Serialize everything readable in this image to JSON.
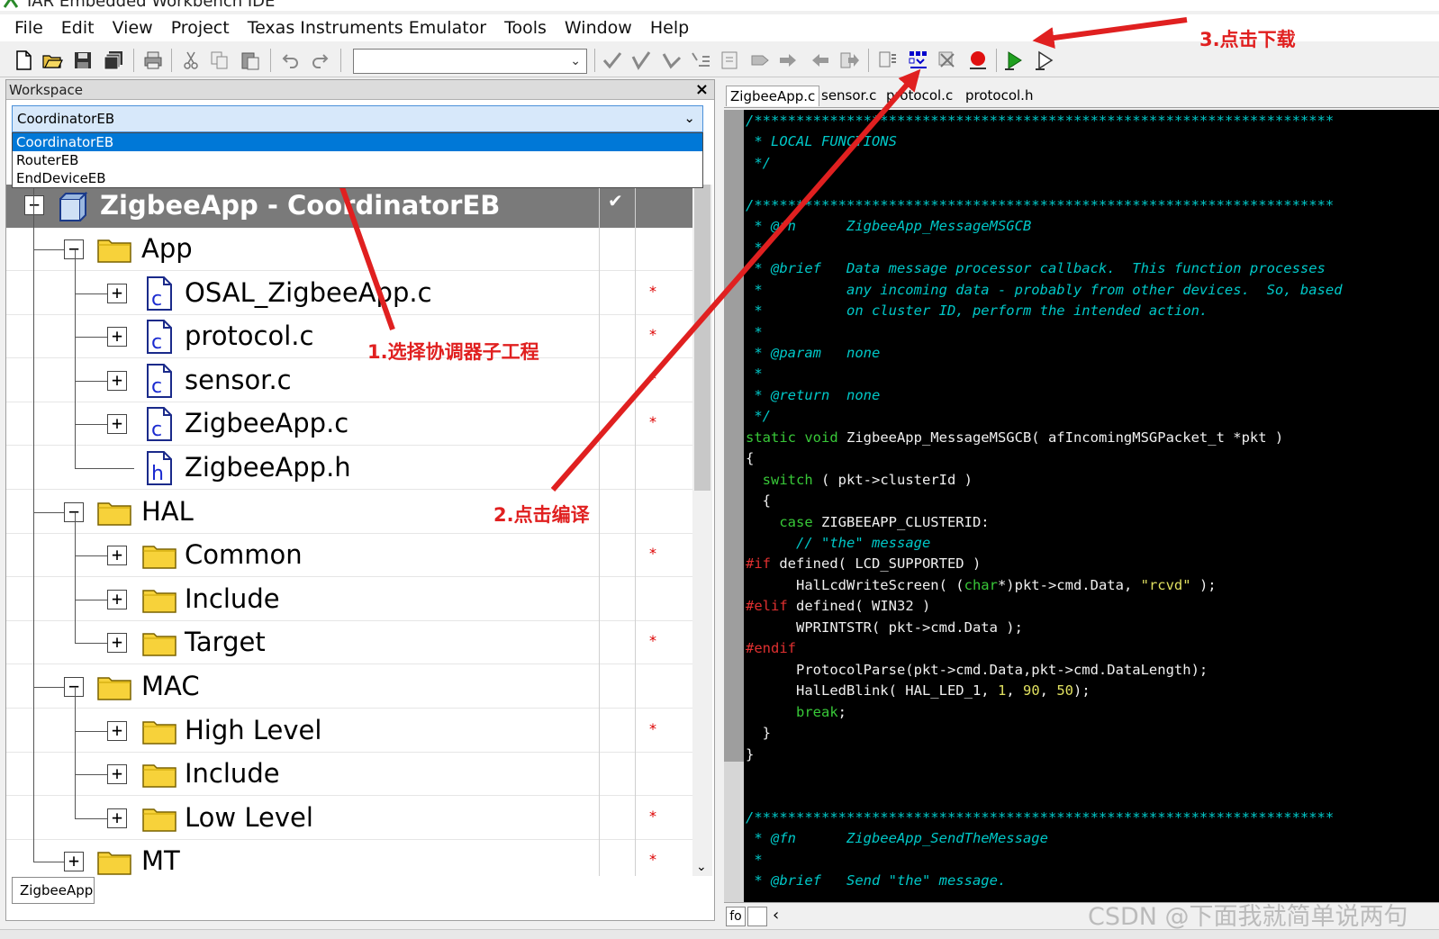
{
  "window": {
    "title": "IAR Embedded Workbench IDE"
  },
  "menu": [
    "File",
    "Edit",
    "View",
    "Project",
    "Texas Instruments Emulator",
    "Tools",
    "Window",
    "Help"
  ],
  "workspace": {
    "header": "Workspace",
    "close": "×",
    "config_selected": "CoordinatorEB",
    "config_options": [
      "CoordinatorEB",
      "RouterEB",
      "EndDeviceEB"
    ],
    "root": "ZigbeeApp - CoordinatorEB",
    "root_check": "✔",
    "tree": [
      {
        "label": "App",
        "kind": "folder",
        "expander": "−"
      },
      {
        "label": "OSAL_ZigbeeApp.c",
        "kind": "c",
        "expander": "+",
        "dot": "*"
      },
      {
        "label": "protocol.c",
        "kind": "c",
        "expander": "+",
        "dot": "*"
      },
      {
        "label": "sensor.c",
        "kind": "c",
        "expander": "+",
        "dot": "*"
      },
      {
        "label": "ZigbeeApp.c",
        "kind": "c",
        "expander": "+",
        "dot": "*"
      },
      {
        "label": "ZigbeeApp.h",
        "kind": "h",
        "expander": ""
      },
      {
        "label": "HAL",
        "kind": "folder",
        "expander": "−"
      },
      {
        "label": "Common",
        "kind": "folder",
        "expander": "+",
        "dot": "*"
      },
      {
        "label": "Include",
        "kind": "folder",
        "expander": "+"
      },
      {
        "label": "Target",
        "kind": "folder",
        "expander": "+",
        "dot": "*"
      },
      {
        "label": "MAC",
        "kind": "folder",
        "expander": "−"
      },
      {
        "label": "High Level",
        "kind": "folder",
        "expander": "+",
        "dot": "*"
      },
      {
        "label": "Include",
        "kind": "folder",
        "expander": "+"
      },
      {
        "label": "Low Level",
        "kind": "folder",
        "expander": "+",
        "dot": "*"
      },
      {
        "label": "MT",
        "kind": "folder",
        "expander": "+",
        "dot": "*"
      }
    ],
    "bottom_tab": "ZigbeeApp"
  },
  "editor": {
    "tabs": [
      "ZigbeeApp.c",
      "sensor.c",
      "protocol.c",
      "protocol.h"
    ],
    "lines": [
      [
        [
          "c-cmt",
          "/*********************************************************************"
        ]
      ],
      [
        [
          "c-cmt",
          " * LOCAL FUNCTIONS"
        ]
      ],
      [
        [
          "c-cmt",
          " */"
        ]
      ],
      [
        [
          "c-txt",
          ""
        ]
      ],
      [
        [
          "c-cmt",
          "/*********************************************************************"
        ]
      ],
      [
        [
          "c-cmt",
          " * @fn      ZigbeeApp_MessageMSGCB"
        ]
      ],
      [
        [
          "c-cmt",
          " *"
        ]
      ],
      [
        [
          "c-cmt",
          " * @brief   Data message processor callback.  This function processes"
        ]
      ],
      [
        [
          "c-cmt",
          " *          any incoming data - probably from other devices.  So, based"
        ]
      ],
      [
        [
          "c-cmt",
          " *          on cluster ID, perform the intended action."
        ]
      ],
      [
        [
          "c-cmt",
          " *"
        ]
      ],
      [
        [
          "c-cmt",
          " * @param   none"
        ]
      ],
      [
        [
          "c-cmt",
          " *"
        ]
      ],
      [
        [
          "c-cmt",
          " * @return  none"
        ]
      ],
      [
        [
          "c-cmt",
          " */"
        ]
      ],
      [
        [
          "c-kw",
          "static void"
        ],
        [
          "c-txt",
          " ZigbeeApp_MessageMSGCB( afIncomingMSGPacket_t *pkt )"
        ]
      ],
      [
        [
          "c-txt",
          "{"
        ]
      ],
      [
        [
          "c-txt",
          "  "
        ],
        [
          "c-kw",
          "switch"
        ],
        [
          "c-txt",
          " ( pkt->clusterId )"
        ]
      ],
      [
        [
          "c-txt",
          "  {"
        ]
      ],
      [
        [
          "c-txt",
          "    "
        ],
        [
          "c-kw",
          "case"
        ],
        [
          "c-txt",
          " ZIGBEEAPP_CLUSTERID:"
        ]
      ],
      [
        [
          "c-txt",
          "      "
        ],
        [
          "c-cmt",
          "// \"the\" message"
        ]
      ],
      [
        [
          "c-pp",
          "#if"
        ],
        [
          "c-txt",
          " defined( LCD_SUPPORTED )"
        ]
      ],
      [
        [
          "c-txt",
          "      HalLcdWriteScreen( ("
        ],
        [
          "c-kw",
          "char"
        ],
        [
          "c-txt",
          "*)pkt->cmd.Data, "
        ],
        [
          "c-str",
          "\"rcvd\""
        ],
        [
          "c-txt",
          " );"
        ]
      ],
      [
        [
          "c-pp",
          "#elif"
        ],
        [
          "c-txt",
          " defined( WIN32 )"
        ]
      ],
      [
        [
          "c-txt",
          "      WPRINTSTR( pkt->cmd.Data );"
        ]
      ],
      [
        [
          "c-pp",
          "#endif"
        ]
      ],
      [
        [
          "c-txt",
          "      ProtocolParse(pkt->cmd.Data,pkt->cmd.DataLength);"
        ]
      ],
      [
        [
          "c-txt",
          "      HalLedBlink( HAL_LED_1, "
        ],
        [
          "c-num",
          "1"
        ],
        [
          "c-txt",
          ", "
        ],
        [
          "c-num",
          "90"
        ],
        [
          "c-txt",
          ", "
        ],
        [
          "c-num",
          "50"
        ],
        [
          "c-txt",
          ");"
        ]
      ],
      [
        [
          "c-txt",
          "      "
        ],
        [
          "c-kw",
          "break"
        ],
        [
          "c-txt",
          ";"
        ]
      ],
      [
        [
          "c-txt",
          "  }"
        ]
      ],
      [
        [
          "c-txt",
          "}"
        ]
      ],
      [
        [
          "c-txt",
          ""
        ]
      ],
      [
        [
          "c-txt",
          ""
        ]
      ],
      [
        [
          "c-cmt",
          "/*********************************************************************"
        ]
      ],
      [
        [
          "c-cmt",
          " * @fn      ZigbeeApp_SendTheMessage"
        ]
      ],
      [
        [
          "c-cmt",
          " *"
        ]
      ],
      [
        [
          "c-cmt",
          " * @brief   Send \"the\" message."
        ]
      ]
    ],
    "bottom_field": "fo"
  },
  "annotations": {
    "step1": "1.选择协调器子工程",
    "step2": "2.点击编译",
    "step3": "3.点击下载"
  },
  "watermark": "CSDN @下面我就简单说两句",
  "colors": {
    "arrow": "#e02020",
    "code_bg": "#000000",
    "comment": "#00c8c8",
    "keyword": "#38c838",
    "preprocessor": "#e03030",
    "selection": "#0078d7"
  }
}
